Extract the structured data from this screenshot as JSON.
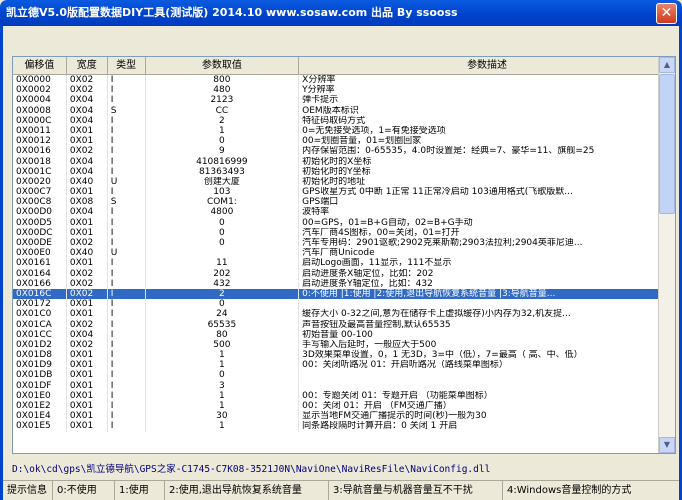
{
  "window": {
    "title": "凯立德V5.0版配置数据DIY工具(测试版) 2014.10   www.sosaw.com 出品 By ssooss",
    "close_symbol": "✕"
  },
  "table": {
    "columns": [
      "偏移值",
      "宽度",
      "类型",
      "参数取值",
      "参数描述"
    ],
    "rows": [
      {
        "offset": "0X0000",
        "width": "0X02",
        "type": "I",
        "value": "800",
        "desc": "X分辨率"
      },
      {
        "offset": "0X0002",
        "width": "0X02",
        "type": "I",
        "value": "480",
        "desc": "Y分辨率"
      },
      {
        "offset": "0X0004",
        "width": "0X04",
        "type": "I",
        "value": "2123",
        "desc": "弹卡提示"
      },
      {
        "offset": "0X0008",
        "width": "0X04",
        "type": "S",
        "value": "CC",
        "desc": "OEM版本标识"
      },
      {
        "offset": "0X000C",
        "width": "0X04",
        "type": "I",
        "value": "2",
        "desc": "特征码取码方式"
      },
      {
        "offset": "0X0011",
        "width": "0X01",
        "type": "I",
        "value": "1",
        "desc": "0=无免接受选项，1=有免接受选项"
      },
      {
        "offset": "0X0012",
        "width": "0X01",
        "type": "I",
        "value": "0",
        "desc": "00=划圈音量，01=划圈回家"
      },
      {
        "offset": "0X0016",
        "width": "0X02",
        "type": "I",
        "value": "9",
        "desc": "内存保留范围：0-65535，4.0时设置是：经典=7、豪华=11、旗舰=25"
      },
      {
        "offset": "0X0018",
        "width": "0X04",
        "type": "I",
        "value": "410816999",
        "desc": "初始化时的X坐标"
      },
      {
        "offset": "0X001C",
        "width": "0X04",
        "type": "I",
        "value": "81363493",
        "desc": "初始化时的Y坐标"
      },
      {
        "offset": "0X0020",
        "width": "0X40",
        "type": "U",
        "value": "创建大厦",
        "desc": "初始化时的地址"
      },
      {
        "offset": "0X00C7",
        "width": "0X01",
        "type": "I",
        "value": "103",
        "desc": "GPS收星方式 0中断 1正常 11正常冷启动 103通用格式(飞歌版默..."
      },
      {
        "offset": "0X00C8",
        "width": "0X08",
        "type": "S",
        "value": "COM1:",
        "desc": "GPS端口"
      },
      {
        "offset": "0X00D0",
        "width": "0X04",
        "type": "I",
        "value": "4800",
        "desc": "波特率"
      },
      {
        "offset": "0X00D5",
        "width": "0X01",
        "type": "I",
        "value": "0",
        "desc": "00=GPS，01=B+G自动，02=B+G手动"
      },
      {
        "offset": "0X00DC",
        "width": "0X01",
        "type": "I",
        "value": "0",
        "desc": "汽车厂商4S图标，00=关闭，01=打开"
      },
      {
        "offset": "0X00DE",
        "width": "0X02",
        "type": "I",
        "value": "0",
        "desc": "汽车专用码：2901讴歌;2902克莱斯勒;2903法拉利;2904英菲尼迪..."
      },
      {
        "offset": "0X00E0",
        "width": "0X40",
        "type": "U",
        "value": "",
        "desc": "汽车厂商Unicode"
      },
      {
        "offset": "0X0161",
        "width": "0X01",
        "type": "I",
        "value": "11",
        "desc": "启动Logo画面，11显示，111不显示"
      },
      {
        "offset": "0X0164",
        "width": "0X02",
        "type": "I",
        "value": "202",
        "desc": "启动进度条X轴定位，比如：202"
      },
      {
        "offset": "0X0166",
        "width": "0X02",
        "type": "I",
        "value": "432",
        "desc": "启动进度条Y轴定位，比如：432"
      },
      {
        "offset": "0X016C",
        "width": "0X02",
        "type": "I",
        "value": "2",
        "desc": "0:不使用 |1:使用 |2:使用,退出导航恢复系统音量 |3:导航音量..."
      },
      {
        "offset": "0X0172",
        "width": "0X01",
        "type": "I",
        "value": "0",
        "desc": ""
      },
      {
        "offset": "0X01C0",
        "width": "0X01",
        "type": "I",
        "value": "24",
        "desc": "缓存大小 0-32之间,意为在储存卡上虚拟缓存)小内存为32,机友提..."
      },
      {
        "offset": "0X01CA",
        "width": "0X02",
        "type": "I",
        "value": "65535",
        "desc": "声音按钮及最高音量控制,默认65535"
      },
      {
        "offset": "0X01CC",
        "width": "0X04",
        "type": "I",
        "value": "80",
        "desc": "初始音量 00-100"
      },
      {
        "offset": "0X01D2",
        "width": "0X02",
        "type": "I",
        "value": "500",
        "desc": "手写输入后延时，一般应大于500"
      },
      {
        "offset": "0X01D8",
        "width": "0X01",
        "type": "I",
        "value": "1",
        "desc": "3D效果菜单设置，0，1 无3D，3=中（低），7=最高（ 高、中、低）"
      },
      {
        "offset": "0X01D9",
        "width": "0X01",
        "type": "I",
        "value": "1",
        "desc": "00：关闭听路况   01：开启听路况（路线菜单图标）"
      },
      {
        "offset": "0X01DB",
        "width": "0X01",
        "type": "I",
        "value": "0",
        "desc": ""
      },
      {
        "offset": "0X01DF",
        "width": "0X01",
        "type": "I",
        "value": "3",
        "desc": ""
      },
      {
        "offset": "0X01E0",
        "width": "0X01",
        "type": "I",
        "value": "1",
        "desc": "00：专题关闭  01：专题开启 （功能菜单图标）"
      },
      {
        "offset": "0X01E2",
        "width": "0X01",
        "type": "I",
        "value": "1",
        "desc": "00：关闭   01：开启 （FM交通广播）"
      },
      {
        "offset": "0X01E4",
        "width": "0X01",
        "type": "I",
        "value": "30",
        "desc": "显示当地FM交通广播提示的时间(秒)一般为30"
      },
      {
        "offset": "0X01E5",
        "width": "0X01",
        "type": "I",
        "value": "1",
        "desc": "同条路段隔时计算开启：0 关闭 1 开启"
      }
    ]
  },
  "path": "D:\\ok\\cd\\gps\\凯立德导航\\GPS之家-C1745-C7K08-3521J0N\\NaviOne\\NaviResFile\\NaviConfig.dll",
  "status": {
    "items": [
      "提示信息",
      "0:不使用",
      "1:使用",
      "2:使用,退出导航恢复系统音量",
      "3:导航音量与机器音量互不干扰",
      "4:Windows音量控制的方式"
    ]
  },
  "selected_row_index": 21,
  "colors": {
    "titlebar": "#0044cc",
    "selection": "#316ac5"
  }
}
